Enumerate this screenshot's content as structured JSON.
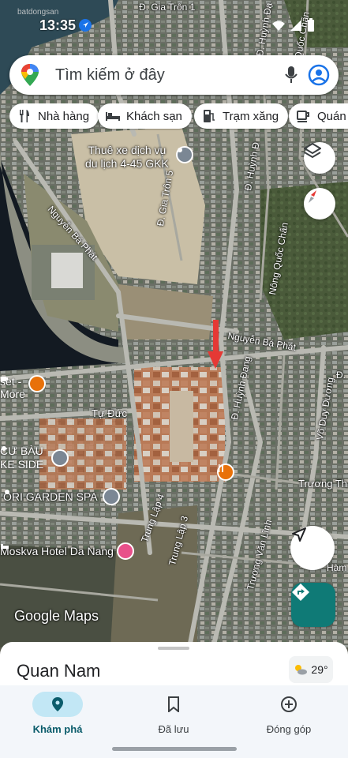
{
  "status": {
    "time": "13:35",
    "watermark": "batdongsan"
  },
  "search": {
    "placeholder": "Tìm kiếm ở đây"
  },
  "chips": [
    {
      "label": "Nhà hàng",
      "icon": "restaurant-icon"
    },
    {
      "label": "Khách sạn",
      "icon": "hotel-icon"
    },
    {
      "label": "Trạm xăng",
      "icon": "gas-station-icon"
    },
    {
      "label": "Quán c",
      "icon": "cafe-icon"
    }
  ],
  "map_labels": {
    "gia_tron_1": "Đ. Gia Trôn 1",
    "gia_tron_5": "Đ. Gia Trôn 5",
    "huynh_dang_1": "Đ. Huỳnh Đạ",
    "huynh_dang_2": "Đ. Huỳnh Đ",
    "huynh_dang_3": "Đ. Huỳnh Đạng",
    "nguyen_ba_phat_1": "Nguyễn Bá Phát",
    "nguyen_ba_phat_2": "Nguyễn Bá Phát",
    "nong_quoc_chan_1": "Nông Quốc Chấn",
    "nong_quoc_chan_2": "Nông Quốc Chấn",
    "tu_duc": "Tự Đức",
    "vo_duy_duong": "Võ Duy Dương",
    "truong_thi": "Trương Th",
    "truong_van_linh": "Trương Văn Lĩnh",
    "trung_lap_4": "Trung Lập 4",
    "trung_lap_3": "Trung Lập 3",
    "ham": "Hàm",
    "d_label": "Đ."
  },
  "pois": {
    "thue_xe_line1": "Thuê xe dịch vụ",
    "thue_xe_line2": "du lịch 4-45 GKK",
    "sunset": "set -",
    "sunset2": "More",
    "cu_bau_1": "CƯ BÀU",
    "cu_bau_2": "KE SIDE",
    "ori_spa": "ORI GARDEN SPA",
    "moskva": "Moskva Hotel Da Nang"
  },
  "google_maps": "Google Maps",
  "sheet": {
    "area_name": "Quan Nam",
    "temperature": "29°"
  },
  "nav": [
    {
      "label": "Khám phá",
      "icon": "explore-icon",
      "active": true
    },
    {
      "label": "Đã lưu",
      "icon": "bookmark-icon",
      "active": false
    },
    {
      "label": "Đóng góp",
      "icon": "add-circle-icon",
      "active": false
    }
  ],
  "colors": {
    "accent": "#0b8043",
    "directions_fab": "#0f7a76",
    "nav_active": "#c2e7f5",
    "marker": "#e53935"
  }
}
